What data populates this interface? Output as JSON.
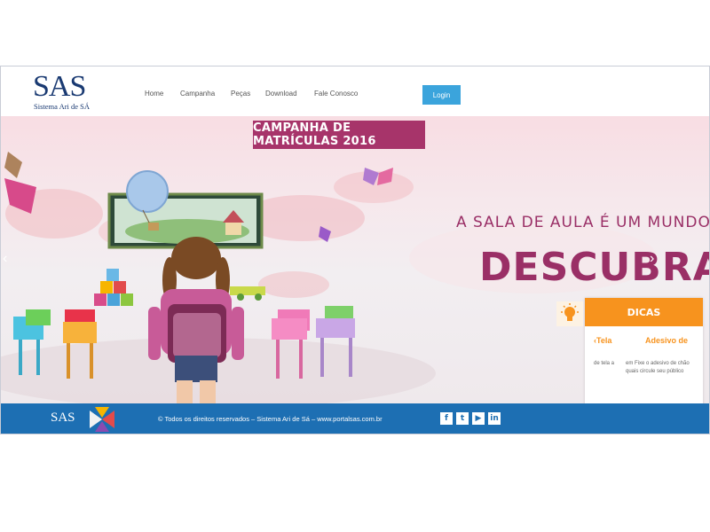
{
  "header": {
    "logo_mark": "SAS",
    "logo_subtitle": "Sistema Ari de SÁ",
    "nav": [
      "Home",
      "Campanha",
      "Peças",
      "Download",
      "Fale Conosco"
    ],
    "login_label": "Login"
  },
  "hero": {
    "campaign_banner": "CAMPANHA DE MATRÍCULAS 2016",
    "tagline": "A SALA DE AULA É UM MUNDO.",
    "headline": "DESCUBRA.",
    "arrow_left": "‹",
    "arrow_right": "›"
  },
  "tips": {
    "title": "DICAS",
    "items": [
      {
        "title": "‹Tela",
        "body": "de  tela  a"
      },
      {
        "title": "Adesivo de",
        "body": "em Fixe o adesivo de chão quais circule seu público"
      }
    ],
    "prev": "‹",
    "next": "›"
  },
  "footer": {
    "logo_mark": "SAS",
    "copyright": "© Todos os direitos reservados – Sistema Ari de Sá – www.portalsas.com.br",
    "social": [
      "f",
      "t",
      "▶",
      "in"
    ]
  },
  "colors": {
    "brand_navy": "#1a3a72",
    "login_blue": "#3ba4dc",
    "campaign_magenta": "#a7346a",
    "headline_plum": "#9a2f66",
    "tips_orange": "#f7931e",
    "footer_blue": "#1d6fb3"
  },
  "icons": {
    "tips": "lightbulb-icon",
    "social": [
      "facebook-icon",
      "twitter-icon",
      "youtube-icon",
      "linkedin-icon"
    ]
  }
}
